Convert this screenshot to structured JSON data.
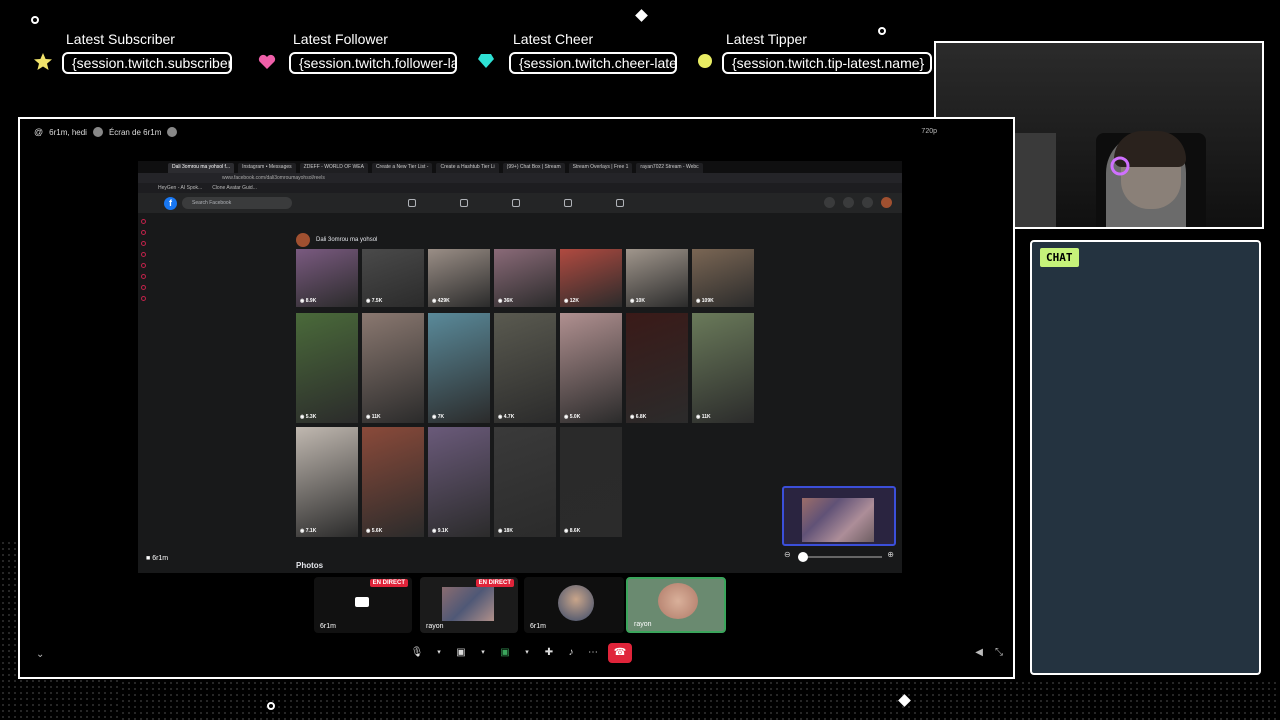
{
  "overlay": {
    "alerts": [
      {
        "label": "Latest Subscriber",
        "value": "{session.twitch.subscriber-latest.name}"
      },
      {
        "label": "Latest Follower",
        "value": "{session.twitch.follower-latest.name}"
      },
      {
        "label": "Latest Cheer",
        "value": "{session.twitch.cheer-latest.name}"
      },
      {
        "label": "Latest Tipper",
        "value": "{session.twitch.tip-latest.name}"
      }
    ],
    "colors": {
      "star": "#f1e36b",
      "heart": "#ef5fa9",
      "cheer": "#2ee1d4",
      "tipper": "#e8ec63",
      "chat_bg": "#243340",
      "chat_tag": "#c6f27a"
    }
  },
  "chat": {
    "title": "CHAT"
  },
  "stream": {
    "header_user": "6r1m, hedi",
    "header_screen": "Écran de 6r1m",
    "resolution": "720p",
    "presenter_tag": "6r1m",
    "browser": {
      "tabs": [
        "Dali 3omrou ma yohsol f...",
        "Instagram • Messages",
        "ZDEFF - WORLD OF WEA",
        "Create a New Tier List -",
        "Create a Hashtub Tier Li",
        "(99+) Chat Box | Stream",
        "Stream Overlays | Free 1",
        "rayan7022 Stream - Webc"
      ],
      "url": "www.facebook.com/dali3omroumayohsol/reels",
      "bookmarks": [
        "HeyGen - AI Spok...",
        "Clone Avatar Guid..."
      ],
      "search_placeholder": "Search Facebook",
      "page_title": "Dali 3omrou ma yohsol",
      "section": "Photos",
      "views_row1": [
        "8.9K",
        "7.5K",
        "429K",
        "36K",
        "12K",
        "10K",
        "109K"
      ],
      "views_row2": [
        "5.3K",
        "11K",
        "7K",
        "4.7K",
        "5.0K",
        "6.8K",
        "11K"
      ],
      "views_row3": [
        "7.1K",
        "5.6K",
        "9.1K",
        "18K",
        "8.6K"
      ]
    },
    "participants": [
      {
        "name": "6r1m",
        "live": "EN DIRECT"
      },
      {
        "name": "rayon",
        "live": "EN DIRECT"
      },
      {
        "name": "6r1m",
        "live": ""
      },
      {
        "name": "rayon",
        "live": ""
      }
    ]
  }
}
